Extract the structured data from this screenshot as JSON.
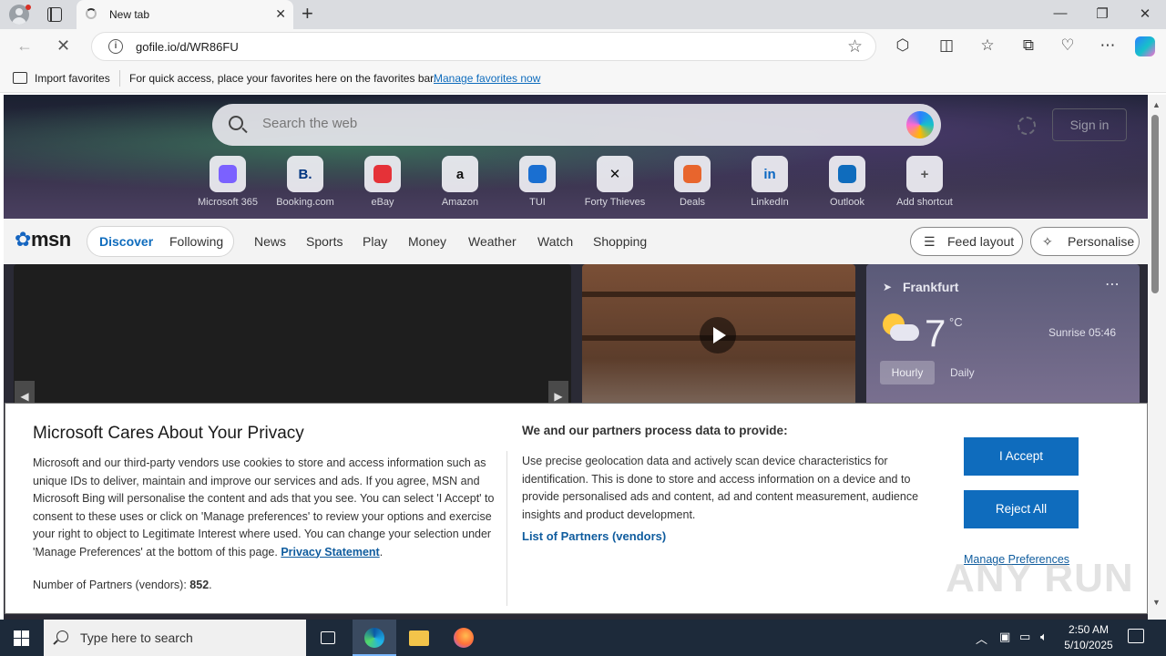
{
  "browser": {
    "tab_title": "New tab",
    "url": "gofile.io/d/WR86FU",
    "favorites_import": "Import favorites",
    "favorites_hint": "For quick access, place your favorites here on the favorites bar.",
    "favorites_link": "Manage favorites now"
  },
  "newtab": {
    "search_placeholder": "Search the web",
    "sign_in": "Sign in",
    "shortcuts": [
      {
        "label": "Microsoft 365",
        "glyph": "",
        "color": "#7b61ff"
      },
      {
        "label": "Booking.com",
        "glyph": "B.",
        "color": "#003580"
      },
      {
        "label": "eBay",
        "glyph": "",
        "color": "#e53238"
      },
      {
        "label": "Amazon",
        "glyph": "a",
        "color": "#111"
      },
      {
        "label": "TUI",
        "glyph": "",
        "color": "#1a6fd1"
      },
      {
        "label": "Forty Thieves",
        "glyph": "✕",
        "color": "#111"
      },
      {
        "label": "Deals",
        "glyph": "",
        "color": "#e8652d"
      },
      {
        "label": "LinkedIn",
        "glyph": "in",
        "color": "#0a66c2"
      },
      {
        "label": "Outlook",
        "glyph": "",
        "color": "#0f6cbd"
      },
      {
        "label": "Add shortcut",
        "glyph": "+",
        "color": "#555"
      }
    ],
    "msn": {
      "logo": "msn",
      "pill_discover": "Discover",
      "pill_following": "Following",
      "nav": [
        "News",
        "Sports",
        "Play",
        "Money",
        "Weather",
        "Watch",
        "Shopping"
      ],
      "feed_layout": "Feed layout",
      "personalise": "Personalise"
    },
    "weather": {
      "location": "Frankfurt",
      "temp": "7",
      "unit": "°C",
      "sunrise": "Sunrise 05:46",
      "tab_hourly": "Hourly",
      "tab_daily": "Daily"
    }
  },
  "privacy": {
    "title": "Microsoft Cares About Your Privacy",
    "body": "Microsoft and our third-party vendors use cookies to store and access information such as unique IDs to deliver, maintain and improve our services and ads. If you agree, MSN and Microsoft Bing will personalise the content and ads that you see. You can select 'I Accept' to consent to these uses or click on 'Manage preferences' to review your options and exercise your right to object to Legitimate Interest where used.  You can change your selection under 'Manage Preferences' at the bottom of this page.",
    "privacy_link": "Privacy Statement",
    "partners_label": "Number of Partners (vendors):",
    "partners_count": "852",
    "heading2": "We and our partners process data to provide:",
    "body2": "Use precise geolocation data and actively scan device characteristics for identification. This is done to store and access information on a device and to provide personalised ads and content, ad and content measurement, audience insights and product development.",
    "partners_list": "List of Partners (vendors)",
    "accept": "I Accept",
    "reject": "Reject All",
    "manage": "Manage Preferences"
  },
  "watermark": "ANY RUN",
  "taskbar": {
    "search_placeholder": "Type here to search",
    "time": "2:50 AM",
    "date": "5/10/2025"
  }
}
